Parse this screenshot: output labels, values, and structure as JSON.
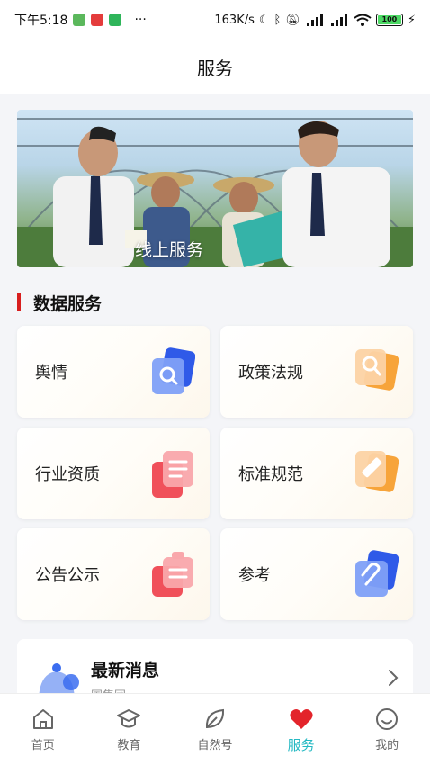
{
  "status_bar": {
    "time": "下午5:18",
    "dots": "···",
    "speed": "163K/s",
    "battery": "100"
  },
  "header": {
    "title": "服务"
  },
  "banner": {
    "caption": "线上服务"
  },
  "section": {
    "title": "数据服务"
  },
  "cards": [
    {
      "label": "舆情",
      "icon": "search-doc-icon",
      "color": "#3b6df0"
    },
    {
      "label": "政策法规",
      "icon": "policy-search-icon",
      "color": "#f59c3a"
    },
    {
      "label": "行业资质",
      "icon": "document-icon",
      "color": "#f0505a"
    },
    {
      "label": "标准规范",
      "icon": "ruler-icon",
      "color": "#f59c3a"
    },
    {
      "label": "公告公示",
      "icon": "notice-icon",
      "color": "#f0505a"
    },
    {
      "label": "参考",
      "icon": "link-icon",
      "color": "#3b6df0"
    }
  ],
  "news": {
    "title": "最新消息",
    "subtitle": "国集团……"
  },
  "nav": [
    {
      "label": "首页",
      "icon": "home-icon"
    },
    {
      "label": "教育",
      "icon": "graduation-cap-icon"
    },
    {
      "label": "自然号",
      "icon": "leaf-icon"
    },
    {
      "label": "服务",
      "icon": "heart-icon",
      "active": true
    },
    {
      "label": "我的",
      "icon": "smile-icon"
    }
  ],
  "colors": {
    "accent": "#25b9c3",
    "section_bar": "#d81e1e",
    "heart": "#e3242b"
  }
}
